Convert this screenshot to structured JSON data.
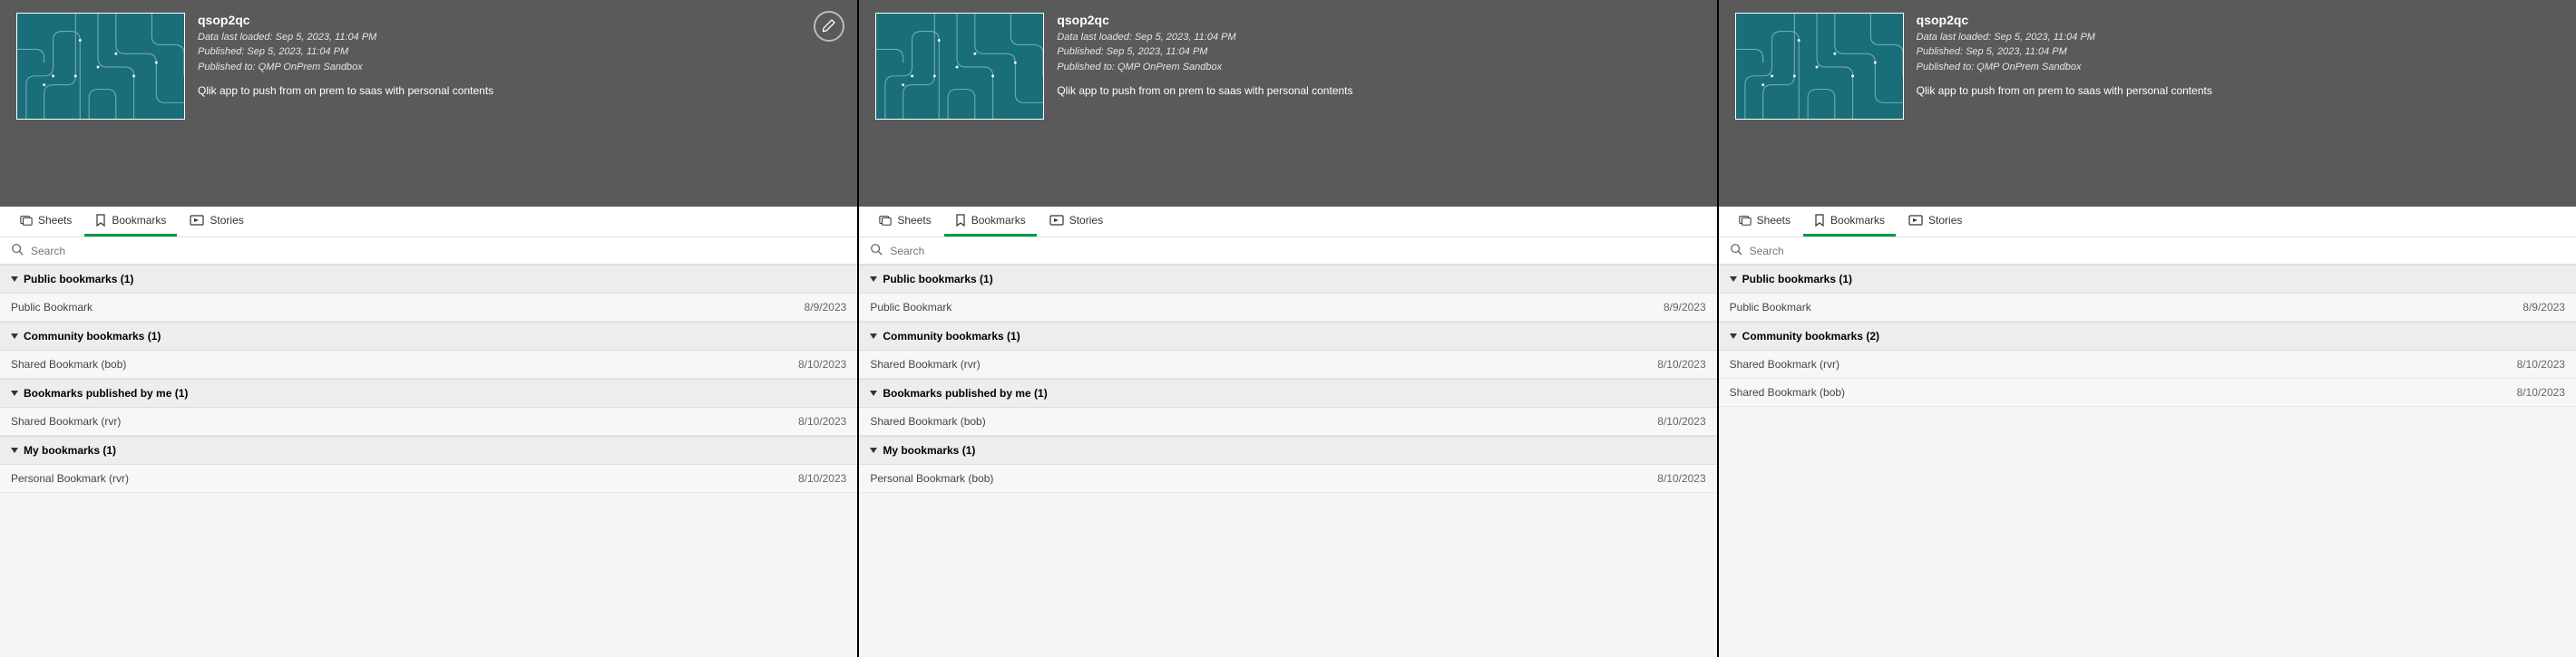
{
  "header": {
    "title": "qsop2qc",
    "data_loaded": "Data last loaded: Sep 5, 2023, 11:04 PM",
    "published": "Published: Sep 5, 2023, 11:04 PM",
    "published_to": "Published to: QMP OnPrem Sandbox",
    "description": "Qlik app to push from on prem to saas with personal contents"
  },
  "tabs": {
    "sheets": "Sheets",
    "bookmarks": "Bookmarks",
    "stories": "Stories"
  },
  "search": {
    "placeholder": "Search"
  },
  "panels": [
    {
      "show_edit": true,
      "groups": [
        {
          "label": "Public bookmarks (1)",
          "items": [
            {
              "name": "Public Bookmark",
              "date": "8/9/2023"
            }
          ]
        },
        {
          "label": "Community bookmarks (1)",
          "items": [
            {
              "name": "Shared Bookmark (bob)",
              "date": "8/10/2023"
            }
          ]
        },
        {
          "label": "Bookmarks published by me (1)",
          "items": [
            {
              "name": "Shared Bookmark (rvr)",
              "date": "8/10/2023"
            }
          ]
        },
        {
          "label": "My bookmarks (1)",
          "items": [
            {
              "name": "Personal Bookmark (rvr)",
              "date": "8/10/2023"
            }
          ]
        }
      ]
    },
    {
      "show_edit": false,
      "groups": [
        {
          "label": "Public bookmarks (1)",
          "items": [
            {
              "name": "Public Bookmark",
              "date": "8/9/2023"
            }
          ]
        },
        {
          "label": "Community bookmarks (1)",
          "items": [
            {
              "name": "Shared Bookmark (rvr)",
              "date": "8/10/2023"
            }
          ]
        },
        {
          "label": "Bookmarks published by me (1)",
          "items": [
            {
              "name": "Shared Bookmark (bob)",
              "date": "8/10/2023"
            }
          ]
        },
        {
          "label": "My bookmarks (1)",
          "items": [
            {
              "name": "Personal Bookmark (bob)",
              "date": "8/10/2023"
            }
          ]
        }
      ]
    },
    {
      "show_edit": false,
      "groups": [
        {
          "label": "Public bookmarks (1)",
          "items": [
            {
              "name": "Public Bookmark",
              "date": "8/9/2023"
            }
          ]
        },
        {
          "label": "Community bookmarks (2)",
          "items": [
            {
              "name": "Shared Bookmark (rvr)",
              "date": "8/10/2023"
            },
            {
              "name": "Shared Bookmark (bob)",
              "date": "8/10/2023"
            }
          ]
        }
      ]
    }
  ]
}
